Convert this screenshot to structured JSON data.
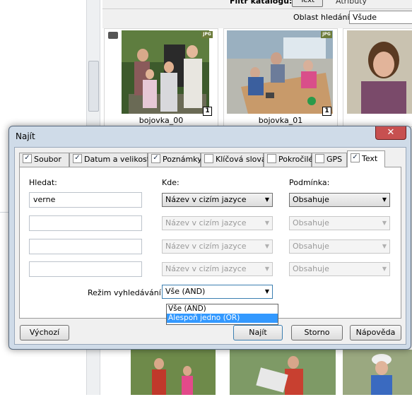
{
  "background": {
    "filter_title": "Filtr katalogu:",
    "filter_mode": "Text",
    "filter_other": "Atributy",
    "scope_label": "Oblast hledání:",
    "scope_value": "Všude",
    "thumbnails": [
      {
        "caption": "bojovka_00",
        "badge": "1",
        "format": "JPG"
      },
      {
        "caption": "bojovka_01",
        "badge": "1",
        "format": "JPG"
      },
      {
        "caption": "",
        "badge": "",
        "format": ""
      }
    ]
  },
  "dialog": {
    "title": "Najít",
    "close_glyph": "✕",
    "tabs": [
      {
        "label": "Soubor",
        "checked": true
      },
      {
        "label": "Datum a velikost",
        "checked": true
      },
      {
        "label": "Poznámky",
        "checked": true
      },
      {
        "label": "Klíčová slova",
        "checked": false
      },
      {
        "label": "Pokročilé",
        "checked": false
      },
      {
        "label": "GPS",
        "checked": false
      },
      {
        "label": "Text",
        "checked": true,
        "active": true
      }
    ],
    "col_search": "Hledat:",
    "col_where": "Kde:",
    "col_condition": "Podmínka:",
    "rows": [
      {
        "search": "verne",
        "where": "Název v cizím jazyce",
        "condition": "Obsahuje"
      },
      {
        "search": "",
        "where": "Název v cizím jazyce",
        "condition": "Obsahuje"
      },
      {
        "search": "",
        "where": "Název v cizím jazyce",
        "condition": "Obsahuje"
      },
      {
        "search": "",
        "where": "Název v cizím jazyce",
        "condition": "Obsahuje"
      }
    ],
    "mode_label": "Režim vyhledávání:",
    "mode_value": "Vše (AND)",
    "mode_options": [
      "Vše (AND)",
      "Alespoň jedno (OR)"
    ],
    "buttons": {
      "default": "Výchozí",
      "find": "Najít",
      "cancel": "Storno",
      "help": "Nápověda"
    }
  }
}
